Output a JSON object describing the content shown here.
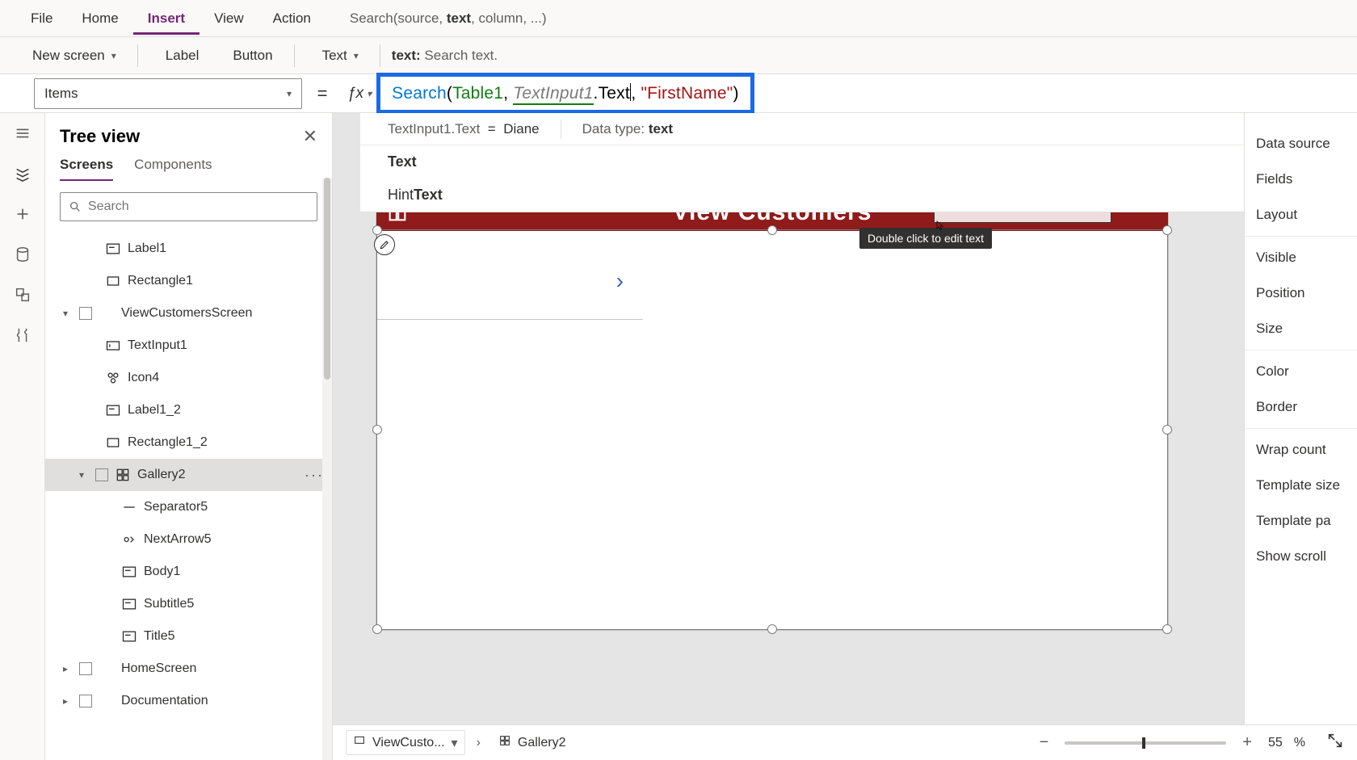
{
  "menu": {
    "file": "File",
    "home": "Home",
    "insert": "Insert",
    "view": "View",
    "action": "Action"
  },
  "search_sig": {
    "pre": "Search(source, ",
    "bold": "text",
    "post": ", column, ...)"
  },
  "toolbar": {
    "new_screen": "New screen",
    "label": "Label",
    "button": "Button",
    "text": "Text"
  },
  "param_hint": {
    "name": "text:",
    "desc": " Search text."
  },
  "prop_selector": "Items",
  "formula": {
    "fn": "Search",
    "open": "(",
    "src": "Table1",
    "comma1": ", ",
    "ctrl": "TextInput1",
    "dot": ".Text",
    "comma2": ", ",
    "str": "\"FirstName\"",
    "close": ")"
  },
  "intelli": {
    "eval_lhs": "TextInput1.Text",
    "eq": "=",
    "eval_rhs": "Diane",
    "dt_label": "Data type: ",
    "dt_val": "text",
    "opt1_bold": "Text",
    "opt2_pre": "Hint",
    "opt2_bold": "Text"
  },
  "tree": {
    "title": "Tree view",
    "tabs": {
      "screens": "Screens",
      "components": "Components"
    },
    "search_ph": "Search",
    "nodes": [
      {
        "type": "label",
        "name": "Label1",
        "depth": 2,
        "chev": ""
      },
      {
        "type": "rect",
        "name": "Rectangle1",
        "depth": 2,
        "chev": ""
      },
      {
        "type": "screen",
        "name": "ViewCustomersScreen",
        "depth": 0,
        "chev": "▾",
        "cb": true
      },
      {
        "type": "text",
        "name": "TextInput1",
        "depth": 2,
        "chev": ""
      },
      {
        "type": "icon",
        "name": "Icon4",
        "depth": 2,
        "chev": ""
      },
      {
        "type": "label",
        "name": "Label1_2",
        "depth": 2,
        "chev": ""
      },
      {
        "type": "rect",
        "name": "Rectangle1_2",
        "depth": 2,
        "chev": ""
      },
      {
        "type": "gallery",
        "name": "Gallery2",
        "depth": 1,
        "chev": "▾",
        "cb": true,
        "sel": true,
        "dots": true
      },
      {
        "type": "sep",
        "name": "Separator5",
        "depth": 3,
        "chev": ""
      },
      {
        "type": "arrow",
        "name": "NextArrow5",
        "depth": 3,
        "chev": ""
      },
      {
        "type": "label",
        "name": "Body1",
        "depth": 3,
        "chev": ""
      },
      {
        "type": "label",
        "name": "Subtitle5",
        "depth": 3,
        "chev": ""
      },
      {
        "type": "label",
        "name": "Title5",
        "depth": 3,
        "chev": ""
      },
      {
        "type": "screen",
        "name": "HomeScreen",
        "depth": 0,
        "chev": "▸",
        "cb": true
      },
      {
        "type": "screen",
        "name": "Documentation",
        "depth": 0,
        "chev": "▸",
        "cb": true
      }
    ]
  },
  "canvas": {
    "banner_text": "View Customers",
    "tooltip": "Double click to edit text"
  },
  "right": [
    "Data source",
    "Fields",
    "Layout",
    "SEP",
    "Visible",
    "Position",
    "Size",
    "SEP",
    "Color",
    "Border",
    "SEP",
    "Wrap count",
    "Template size",
    "Template pa",
    "Show scroll"
  ],
  "status": {
    "crumb1": "ViewCusto...",
    "crumb2": "Gallery2",
    "zoom": "55",
    "pct": "%"
  }
}
